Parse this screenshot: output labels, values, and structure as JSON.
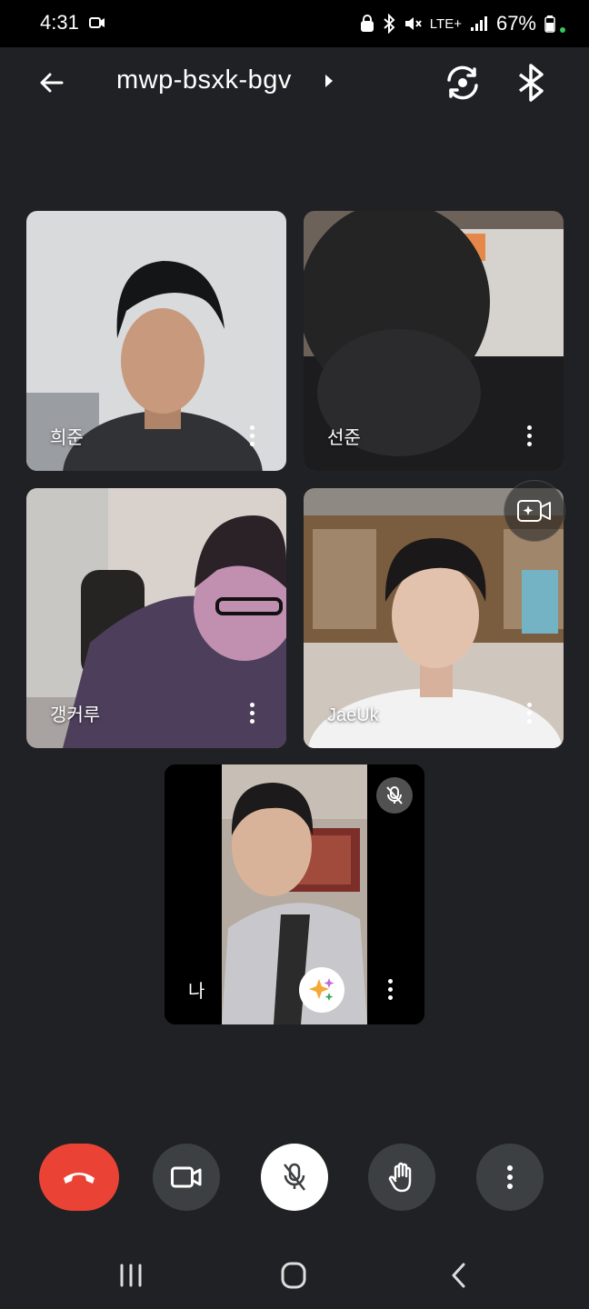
{
  "status_bar": {
    "time": "4:31",
    "network": "LTE+",
    "battery": "67%",
    "icons": [
      "video-record-icon",
      "lock-icon",
      "bluetooth-icon",
      "mute-icon",
      "signal-icon",
      "battery-icon"
    ]
  },
  "app_bar": {
    "meeting_code": "mwp-bsxk-bgv",
    "icons": [
      "back-arrow-icon",
      "caret-right-icon",
      "switch-camera-icon",
      "bluetooth-icon"
    ]
  },
  "participants": [
    {
      "name": "희준"
    },
    {
      "name": "선준"
    },
    {
      "name": "갱커루"
    },
    {
      "name": "JaeUk"
    }
  ],
  "self_tile": {
    "name": "나",
    "icons": [
      "mic-off-icon",
      "sparkle-effects-icon",
      "more-vert-icon"
    ]
  },
  "controls": {
    "icons": [
      "end-call-icon",
      "camera-icon",
      "mic-off-icon",
      "raise-hand-icon",
      "more-vert-icon"
    ],
    "colors": {
      "end_call": "#ea4335",
      "button": "#3c4043",
      "mic_active_bg": "#ffffff"
    }
  },
  "nav_bar": {
    "icons": [
      "recent-apps-icon",
      "home-icon",
      "back-icon"
    ]
  },
  "colors": {
    "background": "#202124",
    "status_bar": "#000000"
  }
}
